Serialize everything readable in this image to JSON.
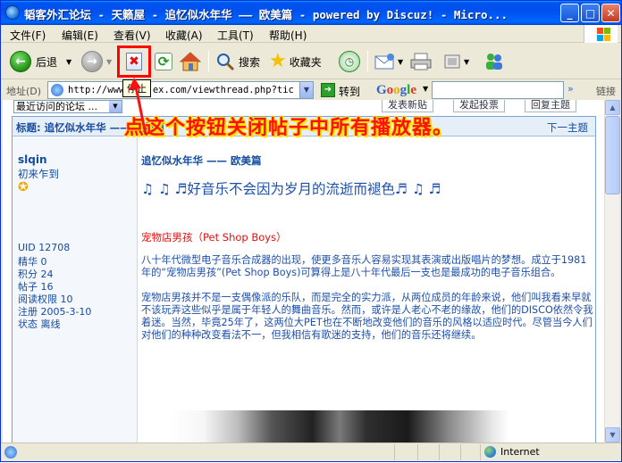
{
  "window": {
    "title": "韬客外汇论坛 - 天籁屋 - 追忆似水年华 —— 欧美篇 - powered by Discuz! - Micro..."
  },
  "menu": [
    "文件(F)",
    "编辑(E)",
    "查看(V)",
    "收藏(A)",
    "工具(T)",
    "帮助(H)"
  ],
  "toolbar": {
    "back_label": "后退",
    "search_label": "搜索",
    "favorites_label": "收藏夹",
    "stop_tooltip": "停止"
  },
  "address": {
    "label": "地址(D)",
    "url": "http://www.t...ex.com/viewthread.php?tic",
    "go_label": "转到",
    "google_letters": [
      {
        "ch": "G",
        "color": "#3366cc"
      },
      {
        "ch": "o",
        "color": "#dd3322"
      },
      {
        "ch": "o",
        "color": "#eeaa00"
      },
      {
        "ch": "g",
        "color": "#3366cc"
      },
      {
        "ch": "l",
        "color": "#22aa33"
      },
      {
        "ch": "e",
        "color": "#dd3322"
      }
    ],
    "links_label": "链接"
  },
  "page": {
    "recent_forums": "最近访问的论坛 ...",
    "buttons": [
      "发表新贴",
      "发起投票",
      "回复主题"
    ],
    "subject": "标题: 追忆似水年华 —— 欧美篇",
    "nav": "下一主题",
    "annotation": "点这个按钮关闭帖子中所有播放器。"
  },
  "user": {
    "name": "slqin",
    "rank": "初来乍到",
    "stats": [
      "UID 12708",
      "精华 0",
      "积分 24",
      "帖子 16",
      "阅读权限 10",
      "注册 2005-3-10",
      "状态 离线"
    ]
  },
  "post": {
    "title": "追忆似水年华 —— 欧美篇",
    "headline": "♫ ♫ ♬好音乐不会因为岁月的流逝而褪色♬ ♫ ♬",
    "band": "宠物店男孩（Pet Shop Boys）",
    "para1": "八十年代微型电子音乐合成器的出现，使更多音乐人容易实现其表演或出版唱片的梦想。成立于1981年的“宠物店男孩”(Pet Shop Boys)可算得上是八十年代最后一支也是最成功的电子音乐组合。",
    "para2": "宠物店男孩并不是一支偶像派的乐队，而是完全的实力派，从两位成员的年龄来说，他们叫我看来早就不该玩弄这些似乎是属于年轻人的舞曲音乐。然而，或许是人老心不老的缘故，他们的DISCO依然令我着迷。当然，毕竟25年了，这两位大PET也在不断地改变他们的音乐的风格以适应时代。尽管当今人们对他们的种种改变看法不一，但我相信有歌迷的支持，他们的音乐还将继续。"
  },
  "status": {
    "zone": "Internet"
  }
}
